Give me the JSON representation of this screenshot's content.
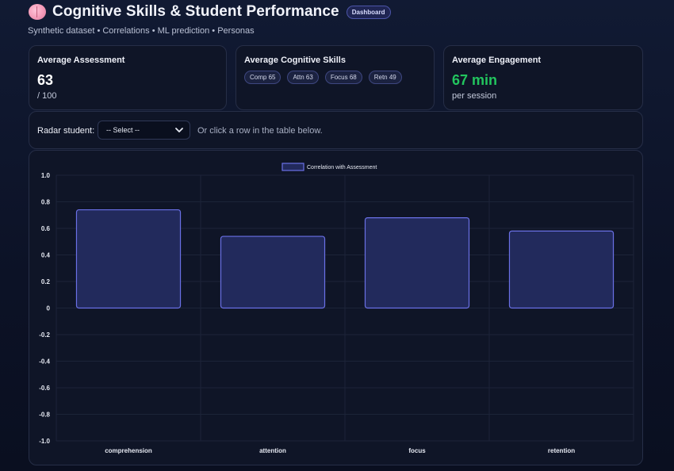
{
  "header": {
    "title": "Cognitive Skills & Student Performance",
    "badge": "Dashboard",
    "subtitle": "Synthetic dataset • Correlations • ML prediction • Personas"
  },
  "cards": {
    "assessment": {
      "title": "Average Assessment",
      "value": "63",
      "sub": "/ 100"
    },
    "cognitive": {
      "title": "Average Cognitive Skills",
      "chips": [
        "Comp 65",
        "Attn 63",
        "Focus 68",
        "Retn 49"
      ]
    },
    "engagement": {
      "title": "Average Engagement",
      "value": "67 min",
      "sub": "per session",
      "value_color": "#22c55e"
    }
  },
  "radar": {
    "label": "Radar student:",
    "select_value": "-- Select --",
    "hint": "Or click a row in the table below."
  },
  "chart_data": {
    "type": "bar",
    "categories": [
      "comprehension",
      "attention",
      "focus",
      "retention"
    ],
    "series": [
      {
        "name": "Correlation with Assessment",
        "values": [
          0.74,
          0.54,
          0.68,
          0.58
        ]
      }
    ],
    "ylim": [
      -1.0,
      1.0
    ],
    "yticks": [
      "1.0",
      "0.8",
      "0.6",
      "0.4",
      "0.2",
      "0",
      "-0.2",
      "-0.4",
      "-0.6",
      "-0.8",
      "-1.0"
    ],
    "grid": true,
    "legend_position": "top-center",
    "colors": {
      "bar_fill": "#222a5c",
      "bar_stroke": "#6a70e6"
    }
  }
}
